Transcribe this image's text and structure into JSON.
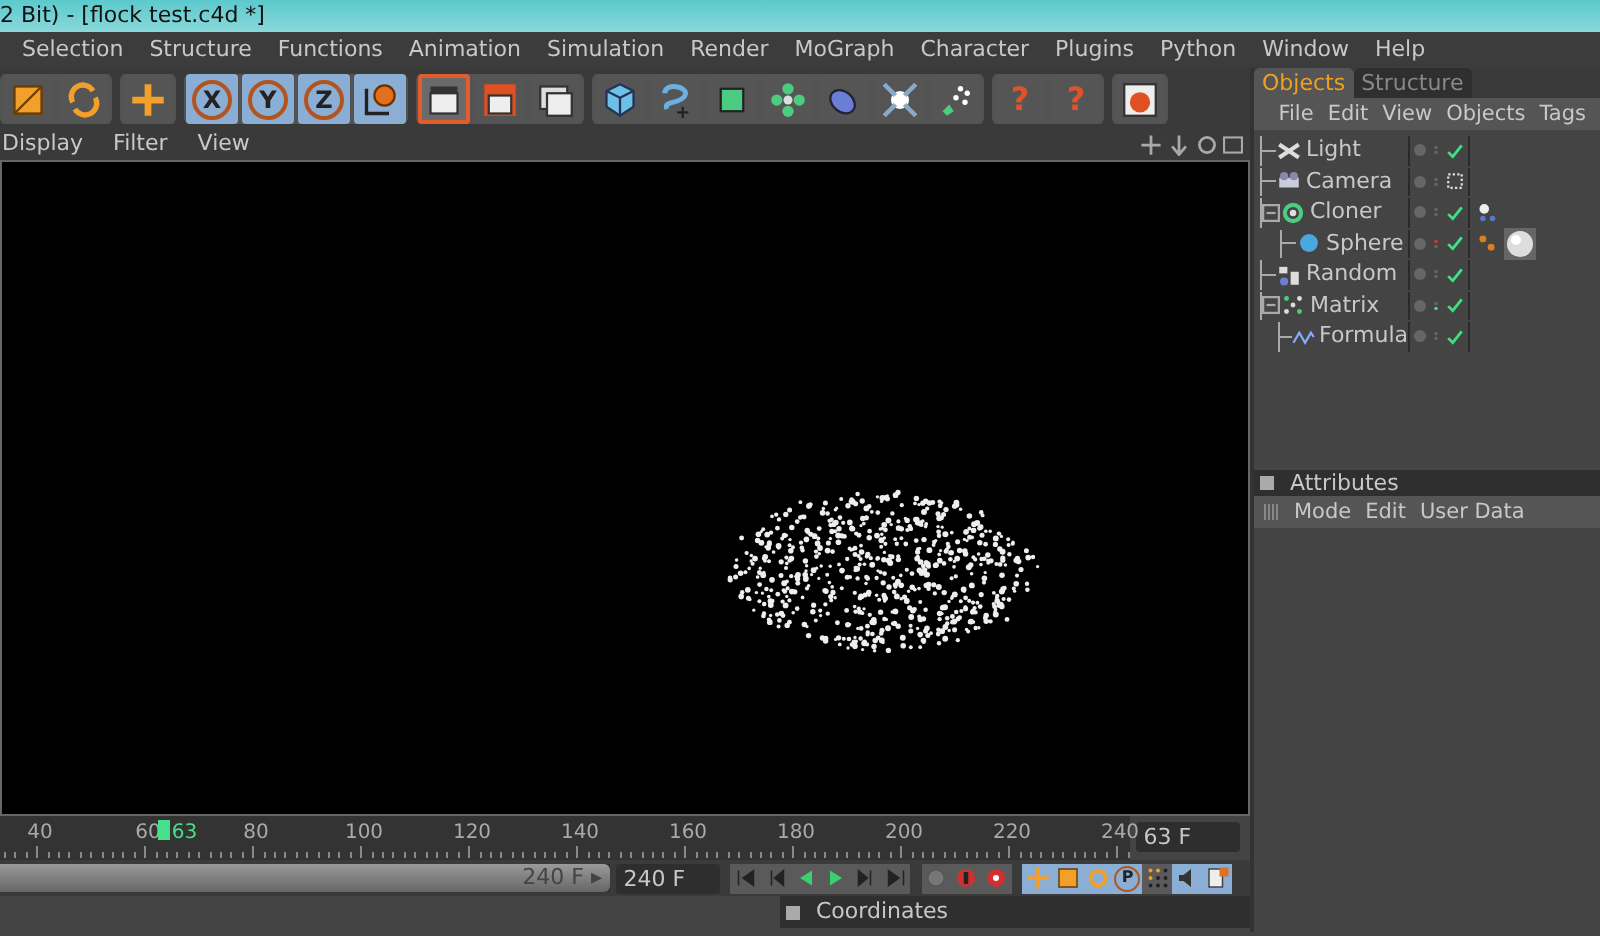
{
  "window": {
    "title": "2 Bit) - [flock test.c4d *]"
  },
  "menu": [
    "Selection",
    "Structure",
    "Functions",
    "Animation",
    "Simulation",
    "Render",
    "MoGraph",
    "Character",
    "Plugins",
    "Python",
    "Window",
    "Help"
  ],
  "toolbar": [
    {
      "buttons": [
        {
          "kind": "scale",
          "on": false
        },
        {
          "kind": "rotate",
          "on": false
        }
      ]
    },
    {
      "buttons": [
        {
          "kind": "move",
          "on": false
        }
      ]
    },
    {
      "buttons": [
        {
          "kind": "axis",
          "label": "X",
          "on": true
        },
        {
          "kind": "axis",
          "label": "Y",
          "on": true
        },
        {
          "kind": "axis",
          "label": "Z",
          "on": true
        },
        {
          "kind": "world",
          "on": true
        }
      ]
    },
    {
      "buttons": [
        {
          "kind": "render-view",
          "on": true
        },
        {
          "kind": "render-picture",
          "on": false
        },
        {
          "kind": "render-settings",
          "on": false
        }
      ]
    },
    {
      "buttons": [
        {
          "kind": "cube",
          "on": false
        },
        {
          "kind": "spline",
          "on": false
        },
        {
          "kind": "nurbs",
          "on": false
        },
        {
          "kind": "array",
          "on": false
        },
        {
          "kind": "deformer",
          "on": false
        },
        {
          "kind": "scene",
          "on": false
        },
        {
          "kind": "particles",
          "on": false
        }
      ]
    },
    {
      "buttons": [
        {
          "kind": "help",
          "label": "?",
          "on": false
        },
        {
          "kind": "help-table",
          "label": "?",
          "on": false
        }
      ]
    },
    {
      "buttons": [
        {
          "kind": "web",
          "on": false
        }
      ]
    }
  ],
  "viewport": {
    "menu": [
      "Display",
      "Filter",
      "View"
    ]
  },
  "timeline": {
    "ticks": [
      "40",
      "60",
      "80",
      "100",
      "120",
      "140",
      "160",
      "180",
      "200",
      "220",
      "240"
    ],
    "playhead": {
      "label": "63",
      "level": 0.145
    },
    "current_frame": "63 F",
    "range_slider": {
      "label": "240 F ▸",
      "level": 1
    },
    "end_frame": "240 F",
    "transport": [
      {
        "kind": "first",
        "on": false
      },
      {
        "kind": "prev-key",
        "on": false
      },
      {
        "kind": "prev",
        "on": false
      },
      {
        "kind": "play",
        "on": false
      },
      {
        "kind": "next-key",
        "on": false
      },
      {
        "kind": "last",
        "on": false
      }
    ],
    "record": [
      {
        "kind": "keyframe",
        "on": false
      },
      {
        "kind": "record",
        "on": false
      },
      {
        "kind": "auto-key",
        "on": false
      }
    ],
    "modes": [
      {
        "kind": "move",
        "on": true
      },
      {
        "kind": "scale",
        "on": true
      },
      {
        "kind": "rotate",
        "on": true
      },
      {
        "kind": "param",
        "label": "P",
        "on": true
      },
      {
        "kind": "grid",
        "on": false
      },
      {
        "kind": "sound",
        "on": true
      },
      {
        "kind": "doc",
        "on": true
      }
    ]
  },
  "coordinates": {
    "title": "Coordinates"
  },
  "objects_panel": {
    "tabs": [
      {
        "label": "Objects",
        "selected": true
      },
      {
        "label": "Structure",
        "selected": false
      }
    ],
    "menu": [
      "File",
      "Edit",
      "View",
      "Objects",
      "Tags"
    ],
    "tree": [
      {
        "name": "Light",
        "kind": "light",
        "checked": true
      },
      {
        "name": "Camera",
        "kind": "camera",
        "checked": false
      },
      {
        "name": "Cloner",
        "kind": "cloner",
        "checked": true,
        "expanded": true,
        "tags": [
          {
            "kind": "mograph"
          }
        ],
        "children": [
          {
            "name": "Sphere",
            "kind": "sphere",
            "checked": true,
            "red_dot": true,
            "tags": [
              {
                "kind": "dots"
              },
              {
                "kind": "material"
              }
            ]
          }
        ]
      },
      {
        "name": "Random",
        "kind": "random",
        "checked": true
      },
      {
        "name": "Matrix",
        "kind": "matrix",
        "checked": true,
        "expanded": true,
        "green_dot": true,
        "children": [
          {
            "name": "Formula",
            "kind": "formula",
            "checked": true
          }
        ]
      }
    ]
  },
  "attributes_panel": {
    "title": "Attributes",
    "menu": [
      "Mode",
      "Edit",
      "User Data"
    ]
  }
}
